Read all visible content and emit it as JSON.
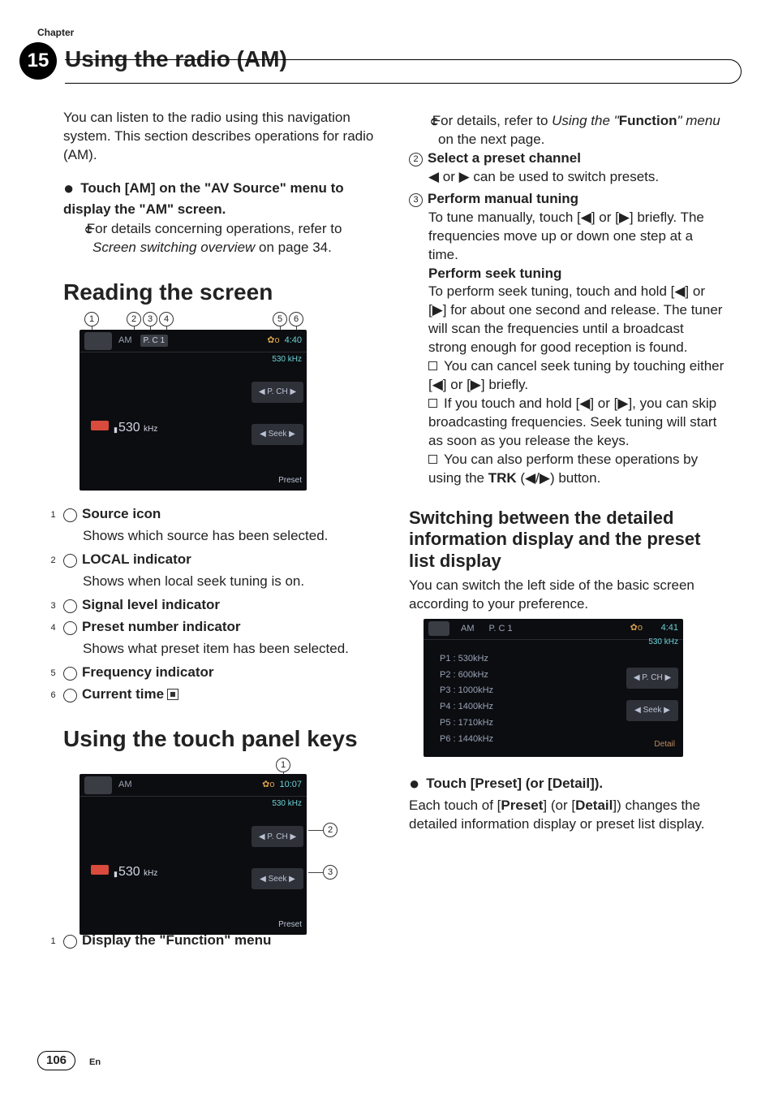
{
  "chapter": {
    "label": "Chapter",
    "number": "15",
    "title": "Using the radio (AM)"
  },
  "intro": "You can listen to the radio using this navigation system. This section describes operations for radio (AM).",
  "step_touch_am": {
    "lead_a": "Touch [AM] on the \"AV Source\" menu to display the \"AM\" screen.",
    "sub_a": "For details concerning operations, refer to ",
    "sub_a_ital": "Screen switching overview",
    "sub_a_tail": " on page 34."
  },
  "reading": {
    "heading": "Reading the screen",
    "items": {
      "i1_title": "Source icon",
      "i1_desc": "Shows which source has been selected.",
      "i2_title": "LOCAL indicator",
      "i2_desc": "Shows when local seek tuning is on.",
      "i3_title": "Signal level indicator",
      "i4_title": "Preset number indicator",
      "i4_desc": "Shows what preset item has been selected.",
      "i5_title": "Frequency indicator",
      "i6_title": "Current time"
    },
    "shot": {
      "am": "AM",
      "pc": "P. C  1",
      "clock": "4:40",
      "freqtop": "530 kHz",
      "pch": "◀ P. CH ▶",
      "seek": "◀  Seek  ▶",
      "preset": "Preset",
      "freq": "530",
      "freq_unit": "kHz"
    }
  },
  "touchkeys": {
    "heading": "Using the touch panel keys",
    "shot": {
      "am": "AM",
      "clock": "10:07",
      "freqtop": "530 kHz",
      "pch": "◀ P. CH ▶",
      "seek": "◀  Seek  ▶",
      "preset": "Preset",
      "freq": "530",
      "freq_unit": "kHz"
    },
    "item1": "Display the \"Function\" menu"
  },
  "rightcol": {
    "ref_a": "For details, refer to ",
    "ref_ital": "Using the \"",
    "ref_bold": "Function",
    "ref_tail_ital": "\" menu",
    "ref_tail": " on the next page.",
    "i2_title": "Select a preset channel",
    "i2_body": "◀ or ▶ can be used to switch presets.",
    "i3_title": "Perform manual tuning",
    "i3_body": "To tune manually, touch [◀] or [▶] briefly. The frequencies move up or down one step at a time.",
    "i3_sub_title": "Perform seek tuning",
    "i3_sub_body": "To perform seek tuning, touch and hold [◀] or [▶] for about one second and release. The tuner will scan the frequencies until a broadcast strong enough for good reception is found.",
    "sq1": "You can cancel seek tuning by touching either [◀] or [▶] briefly.",
    "sq2": "If you touch and hold [◀] or [▶], you can skip broadcasting frequencies. Seek tuning will start as soon as you release the keys.",
    "sq3_a": "You can also perform these operations by using the ",
    "sq3_bold": "TRK",
    "sq3_b": " (◀/▶) button."
  },
  "switching": {
    "heading": "Switching between the detailed information display and the preset list display",
    "intro": "You can switch the left side of the basic screen according to your preference.",
    "shot": {
      "am": "AM",
      "pc": "P. C  1",
      "clock": "4:41",
      "freqtop": "530 kHz",
      "pch": "◀ P. CH ▶",
      "seek": "◀  Seek  ▶",
      "detail": "Detail",
      "p1": "P1 : 530kHz",
      "p2": "P2 : 600kHz",
      "p3": "P3 : 1000kHz",
      "p4": "P4 : 1400kHz",
      "p5": "P5 : 1710kHz",
      "p6": "P6 : 1440kHz"
    },
    "step_title": "Touch [Preset] (or [Detail]).",
    "step_body_a": "Each touch of [",
    "step_body_b": "Preset",
    "step_body_c": "] (or [",
    "step_body_d": "Detail",
    "step_body_e": "]) changes the detailed information display or preset list display."
  },
  "page": {
    "num": "106",
    "lang": "En"
  }
}
